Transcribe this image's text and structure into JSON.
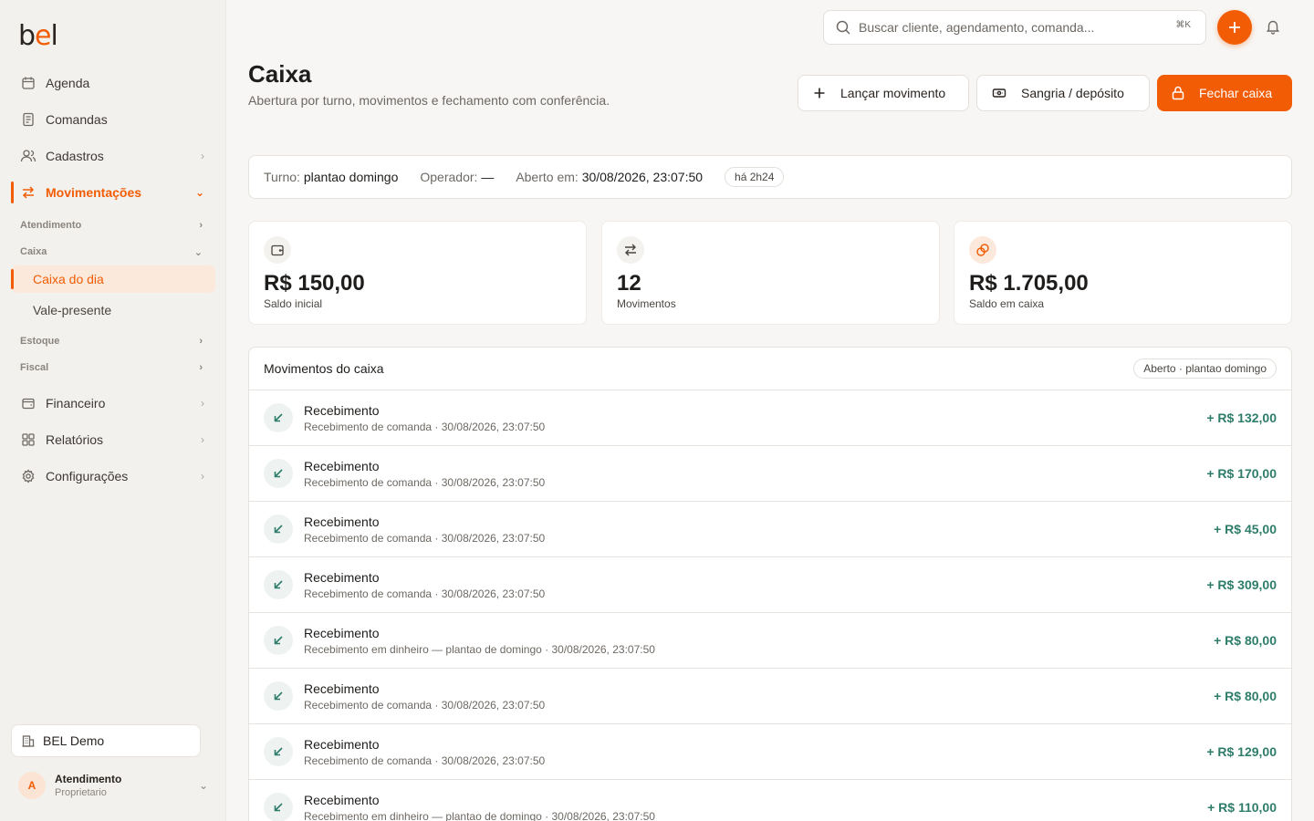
{
  "app": {
    "logo": "bel"
  },
  "sidebar": {
    "items": [
      {
        "label": "Agenda",
        "icon": "calendar-icon"
      },
      {
        "label": "Comandas",
        "icon": "receipt-icon"
      },
      {
        "label": "Cadastros",
        "icon": "users-icon"
      },
      {
        "label": "Movimentações",
        "icon": "transfer-icon"
      }
    ],
    "groups": [
      {
        "label": "Atendimento"
      },
      {
        "label": "Caixa"
      },
      {
        "label": "Estoque"
      },
      {
        "label": "Fiscal"
      }
    ],
    "caixa_items": [
      {
        "label": "Caixa do dia"
      },
      {
        "label": "Vale-presente"
      }
    ],
    "bottom_items": [
      {
        "label": "Financeiro",
        "icon": "wallet-icon"
      },
      {
        "label": "Relatórios",
        "icon": "grid-icon"
      },
      {
        "label": "Configurações",
        "icon": "gear-icon"
      }
    ],
    "company": "BEL Demo",
    "user": {
      "initial": "A",
      "name": "Atendimento",
      "role": "Proprietario"
    }
  },
  "topbar": {
    "search_placeholder": "Buscar cliente, agendamento, comanda...",
    "shortcut": "⌘K"
  },
  "header": {
    "title": "Caixa",
    "subtitle": "Abertura por turno, movimentos e fechamento com conferência.",
    "actions": {
      "launch": "Lançar movimento",
      "sangria": "Sangria / depósito",
      "close": "Fechar caixa"
    }
  },
  "shift": {
    "turno_label": "Turno:",
    "turno_value": "plantao domingo",
    "operador_label": "Operador:",
    "operador_value": "—",
    "aberto_label": "Aberto em:",
    "aberto_value": "30/08/2026, 23:07:50",
    "duration": "há 2h24"
  },
  "stats": [
    {
      "value": "R$ 150,00",
      "label": "Saldo inicial",
      "icon": "wallet-icon"
    },
    {
      "value": "12",
      "label": "Movimentos",
      "icon": "arrows-icon"
    },
    {
      "value": "R$ 1.705,00",
      "label": "Saldo em caixa",
      "icon": "coins-icon"
    }
  ],
  "movements": {
    "title": "Movimentos do caixa",
    "status": "Aberto · plantao domingo",
    "rows": [
      {
        "title": "Recebimento",
        "desc": "Recebimento de comanda · 30/08/2026, 23:07:50",
        "amount": "+ R$ 132,00"
      },
      {
        "title": "Recebimento",
        "desc": "Recebimento de comanda · 30/08/2026, 23:07:50",
        "amount": "+ R$ 170,00"
      },
      {
        "title": "Recebimento",
        "desc": "Recebimento de comanda · 30/08/2026, 23:07:50",
        "amount": "+ R$ 45,00"
      },
      {
        "title": "Recebimento",
        "desc": "Recebimento de comanda · 30/08/2026, 23:07:50",
        "amount": "+ R$ 309,00"
      },
      {
        "title": "Recebimento",
        "desc": "Recebimento em dinheiro — plantao de domingo · 30/08/2026, 23:07:50",
        "amount": "+ R$ 80,00"
      },
      {
        "title": "Recebimento",
        "desc": "Recebimento de comanda · 30/08/2026, 23:07:50",
        "amount": "+ R$ 80,00"
      },
      {
        "title": "Recebimento",
        "desc": "Recebimento de comanda · 30/08/2026, 23:07:50",
        "amount": "+ R$ 129,00"
      },
      {
        "title": "Recebimento",
        "desc": "Recebimento em dinheiro — plantao de domingo · 30/08/2026, 23:07:50",
        "amount": "+ R$ 110,00"
      }
    ]
  },
  "colors": {
    "accent": "#f25c05",
    "positive": "#2e7d6a"
  }
}
